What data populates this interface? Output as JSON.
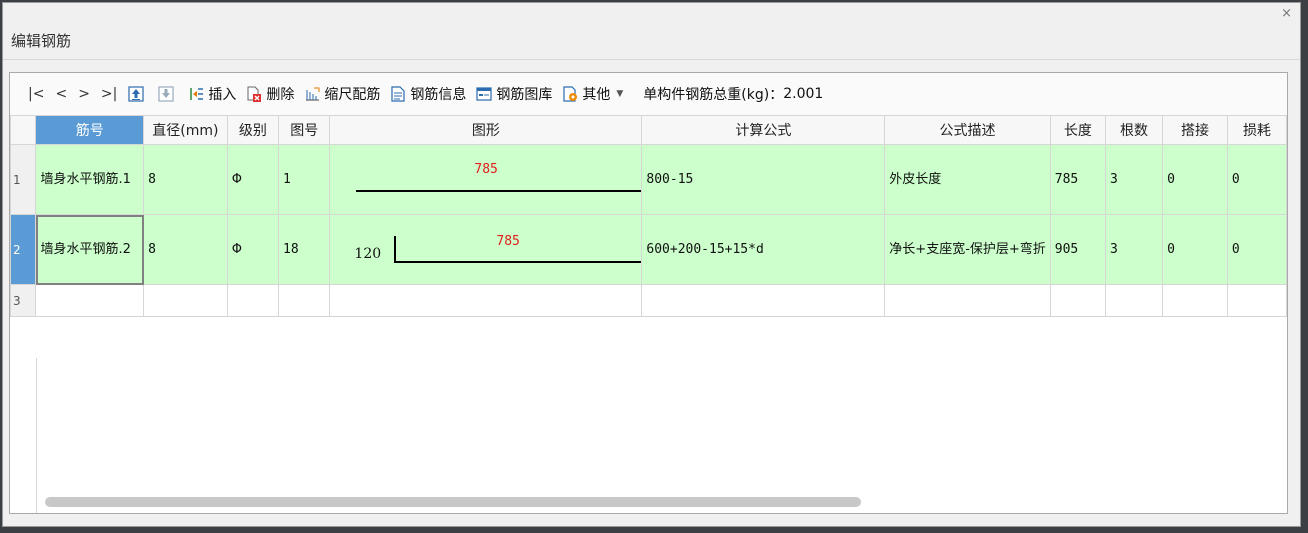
{
  "window": {
    "title": "编辑钢筋",
    "close_glyph": "×"
  },
  "toolbar": {
    "nav": [
      "|<",
      "<",
      ">",
      ">|"
    ],
    "buttons": [
      {
        "id": "move-up",
        "icon": "arrow-up-icon",
        "label": ""
      },
      {
        "id": "move-down",
        "icon": "arrow-down-icon",
        "label": ""
      },
      {
        "id": "insert",
        "icon": "insert-icon",
        "label": "插入"
      },
      {
        "id": "delete",
        "icon": "delete-icon",
        "label": "删除"
      },
      {
        "id": "scale",
        "icon": "scale-rebar-icon",
        "label": "缩尺配筋"
      },
      {
        "id": "info",
        "icon": "rebar-info-icon",
        "label": "钢筋信息"
      },
      {
        "id": "library",
        "icon": "rebar-library-icon",
        "label": "钢筋图库"
      },
      {
        "id": "other",
        "icon": "other-icon",
        "label": "其他"
      }
    ],
    "total_label": "单构件钢筋总重(kg)：",
    "total_value": "2.001"
  },
  "grid": {
    "columns": [
      "筋号",
      "直径(mm)",
      "级别",
      "图号",
      "图形",
      "计算公式",
      "公式描述",
      "长度",
      "根数",
      "搭接",
      "损耗"
    ],
    "rows": [
      {
        "index": "1",
        "name": "墙身水平钢筋.1",
        "diameter": "8",
        "grade": "Φ",
        "shape_no": "1",
        "shape_main": "785",
        "shape_hook": "",
        "formula": "800-15",
        "description": "外皮长度",
        "length": "785",
        "count": "3",
        "lap": "0",
        "loss": "0"
      },
      {
        "index": "2",
        "name": "墙身水平钢筋.2",
        "diameter": "8",
        "grade": "Φ",
        "shape_no": "18",
        "shape_main": "785",
        "shape_hook": "120",
        "formula": "600+200-15+15*d",
        "description": "净长+支座宽-保护层+弯折",
        "length": "905",
        "count": "3",
        "lap": "0",
        "loss": "0"
      }
    ],
    "empty_row_index": "3"
  },
  "colors": {
    "row_bg": "#ccffcc",
    "header_active": "#5b9bd5",
    "shape_label": "#e0201c"
  }
}
